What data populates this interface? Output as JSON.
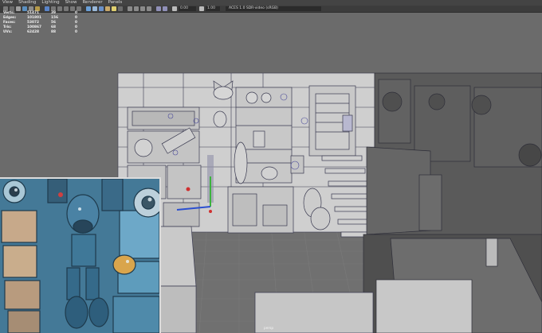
{
  "menu": [
    "View",
    "Shading",
    "Lighting",
    "Show",
    "Renderer",
    "Panels"
  ],
  "toolbar": {
    "value1": "0.00",
    "value2": "1.00",
    "colorspace": "ACES 1.0 SDR-video (sRGB)"
  },
  "hud": {
    "rows": [
      {
        "label": "Verts:",
        "v1": "51471",
        "v2": "39",
        "v3": "0"
      },
      {
        "label": "Edges:",
        "v1": "101801",
        "v2": "156",
        "v3": "0"
      },
      {
        "label": "Faces:",
        "v1": "53072",
        "v2": "56",
        "v3": "0"
      },
      {
        "label": "Tris:",
        "v1": "100867",
        "v2": "68",
        "v3": "0"
      },
      {
        "label": "UVs:",
        "v1": "62428",
        "v2": "88",
        "v3": "0"
      }
    ]
  },
  "camera_label": "persp",
  "colors": {
    "bg": "#6b6b6b",
    "model": "#c8c8c8",
    "dark_model": "#5a5a5a",
    "wire": "#3a3a50",
    "selection": "#4a4a9a"
  },
  "reference_image": {
    "icon": "robot-reference-image"
  }
}
